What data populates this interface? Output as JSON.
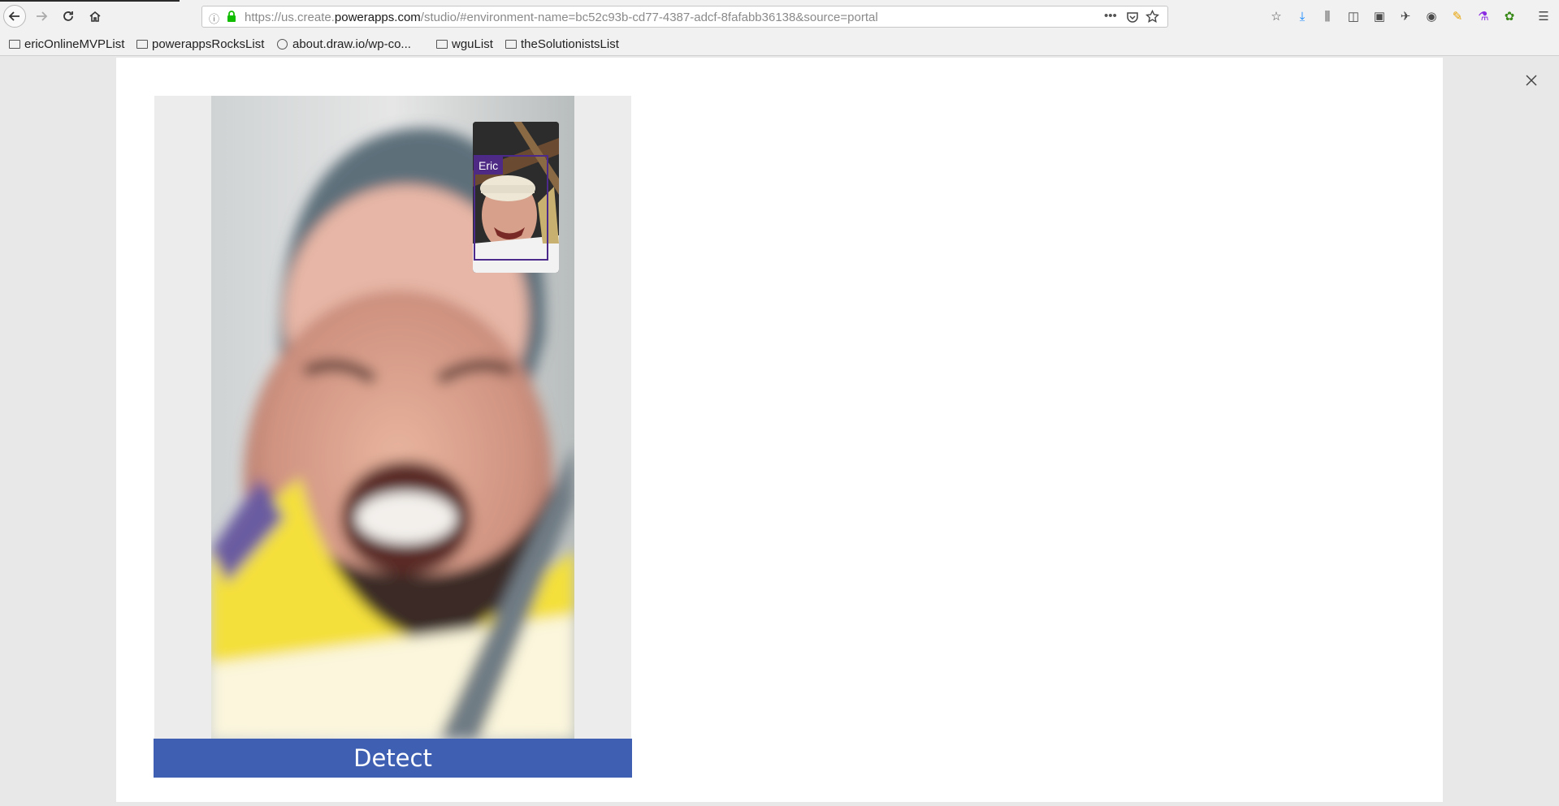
{
  "browser": {
    "url_prefix": "https://us.create.",
    "url_domain": "powerapps.com",
    "url_suffix": "/studio/#environment-name=bc52c93b-cd77-4387-adcf-8fafabb36138&source=portal",
    "icons": [
      "back-icon",
      "forward-icon",
      "reload-icon",
      "home-icon",
      "info-icon",
      "lock-icon",
      "more-icon",
      "pocket-icon",
      "star-icon",
      "reading-list-icon",
      "download-icon",
      "library-icon",
      "sidebar-icon",
      "screenshot-icon",
      "extension-icon",
      "account-icon",
      "extension-icon",
      "extension-icon",
      "extension-icon",
      "menu-icon"
    ]
  },
  "bookmarks": [
    {
      "label": "ericOnlineMVPList",
      "icon": "folder-icon"
    },
    {
      "label": "powerappsRocksList",
      "icon": "folder-icon"
    },
    {
      "label": "about.draw.io/wp-co...",
      "icon": "globe-icon"
    },
    {
      "label": "wguList",
      "icon": "folder-icon"
    },
    {
      "label": "theSolutionistsList",
      "icon": "folder-icon"
    }
  ],
  "app": {
    "face_tag": "Eric",
    "detect_label": "Detect",
    "close_icon": "close-icon"
  },
  "colors": {
    "detect_button": "#3f5fb2",
    "face_tag": "#4e2a84",
    "face_box": "#4b2a8c"
  }
}
